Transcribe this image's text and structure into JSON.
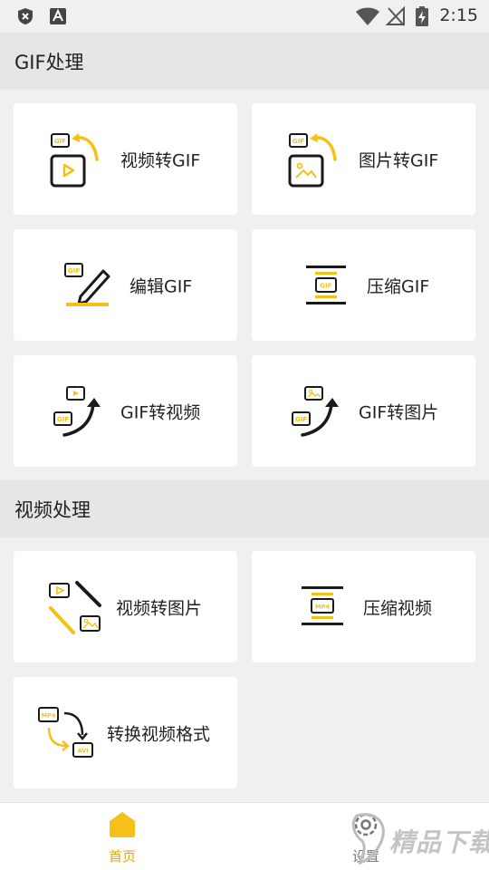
{
  "status_bar": {
    "time": "2:15"
  },
  "sections": [
    {
      "title": "GIF处理",
      "cards": [
        {
          "label": "视频转GIF",
          "icon": "video-to-gif-icon"
        },
        {
          "label": "图片转GIF",
          "icon": "image-to-gif-icon"
        },
        {
          "label": "编辑GIF",
          "icon": "edit-gif-icon"
        },
        {
          "label": "压缩GIF",
          "icon": "compress-gif-icon"
        },
        {
          "label": "GIF转视频",
          "icon": "gif-to-video-icon"
        },
        {
          "label": "GIF转图片",
          "icon": "gif-to-image-icon"
        }
      ]
    },
    {
      "title": "视频处理",
      "cards": [
        {
          "label": "视频转图片",
          "icon": "video-to-image-icon"
        },
        {
          "label": "压缩视频",
          "icon": "compress-video-icon"
        },
        {
          "label": "转换视频格式",
          "icon": "convert-format-icon"
        }
      ]
    }
  ],
  "icon_tags": {
    "gif": "GIF",
    "mp4": "MP4",
    "avi": "AVI"
  },
  "tabbar": {
    "home_label": "首页",
    "settings_label": "设置"
  },
  "watermark_text": "精品下载",
  "colors": {
    "accent": "#f5c118",
    "dark": "#1a1a1a",
    "background": "#f0f0f0",
    "section_bg": "#e6e6e6"
  }
}
